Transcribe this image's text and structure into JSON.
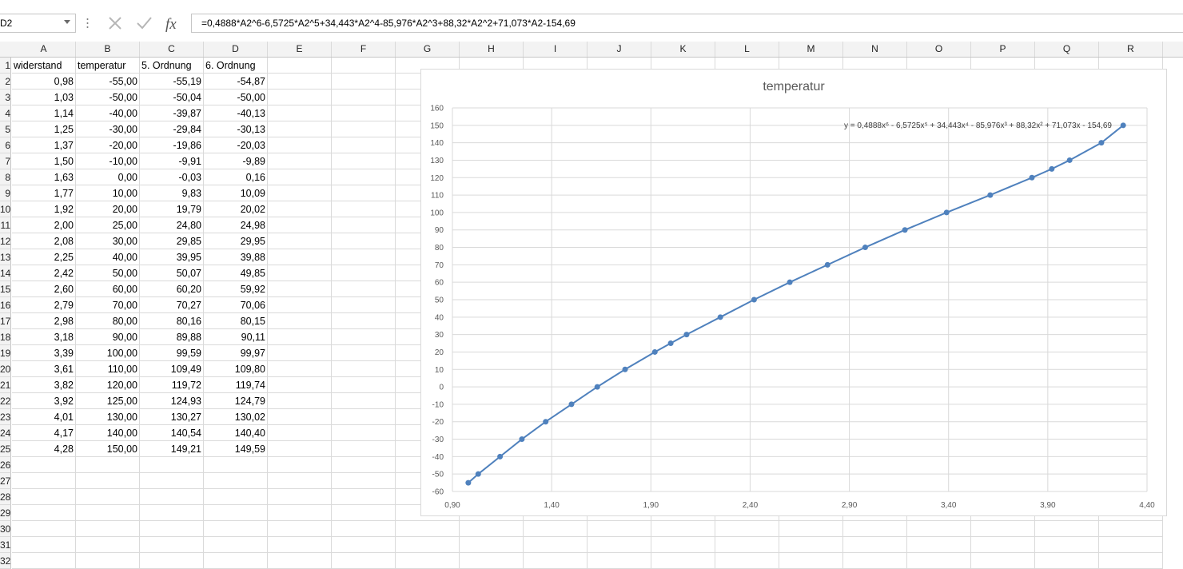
{
  "name_box": {
    "value": "D2"
  },
  "formula_bar": {
    "formula": "=0,4888*A2^6-6,5725*A2^5+34,443*A2^4-85,976*A2^3+88,32*A2^2+71,073*A2-154,69"
  },
  "columns": [
    "A",
    "B",
    "C",
    "D",
    "E",
    "F",
    "G",
    "H",
    "I",
    "J",
    "K",
    "L",
    "M",
    "N",
    "O",
    "P",
    "Q",
    "R"
  ],
  "rows": [
    "1",
    "2",
    "3",
    "4",
    "5",
    "6",
    "7",
    "8",
    "9",
    "10",
    "11",
    "12",
    "13",
    "14",
    "15",
    "16",
    "17",
    "18",
    "19",
    "20",
    "21",
    "22",
    "23",
    "24",
    "25",
    "26",
    "27",
    "28",
    "29",
    "30",
    "31",
    "32"
  ],
  "headers": [
    "widerstand",
    "temperatur",
    "5. Ordnung",
    "6. Ordnung"
  ],
  "table": [
    [
      "0,98",
      "-55,00",
      "-55,19",
      "-54,87"
    ],
    [
      "1,03",
      "-50,00",
      "-50,04",
      "-50,00"
    ],
    [
      "1,14",
      "-40,00",
      "-39,87",
      "-40,13"
    ],
    [
      "1,25",
      "-30,00",
      "-29,84",
      "-30,13"
    ],
    [
      "1,37",
      "-20,00",
      "-19,86",
      "-20,03"
    ],
    [
      "1,50",
      "-10,00",
      "-9,91",
      "-9,89"
    ],
    [
      "1,63",
      "0,00",
      "-0,03",
      "0,16"
    ],
    [
      "1,77",
      "10,00",
      "9,83",
      "10,09"
    ],
    [
      "1,92",
      "20,00",
      "19,79",
      "20,02"
    ],
    [
      "2,00",
      "25,00",
      "24,80",
      "24,98"
    ],
    [
      "2,08",
      "30,00",
      "29,85",
      "29,95"
    ],
    [
      "2,25",
      "40,00",
      "39,95",
      "39,88"
    ],
    [
      "2,42",
      "50,00",
      "50,07",
      "49,85"
    ],
    [
      "2,60",
      "60,00",
      "60,20",
      "59,92"
    ],
    [
      "2,79",
      "70,00",
      "70,27",
      "70,06"
    ],
    [
      "2,98",
      "80,00",
      "80,16",
      "80,15"
    ],
    [
      "3,18",
      "90,00",
      "89,88",
      "90,11"
    ],
    [
      "3,39",
      "100,00",
      "99,59",
      "99,97"
    ],
    [
      "3,61",
      "110,00",
      "109,49",
      "109,80"
    ],
    [
      "3,82",
      "120,00",
      "119,72",
      "119,74"
    ],
    [
      "3,92",
      "125,00",
      "124,93",
      "124,79"
    ],
    [
      "4,01",
      "130,00",
      "130,27",
      "130,02"
    ],
    [
      "4,17",
      "140,00",
      "140,54",
      "140,40"
    ],
    [
      "4,28",
      "150,00",
      "149,21",
      "149,59"
    ]
  ],
  "chart_data": {
    "type": "scatter",
    "title": "temperatur",
    "x": [
      0.98,
      1.03,
      1.14,
      1.25,
      1.37,
      1.5,
      1.63,
      1.77,
      1.92,
      2.0,
      2.08,
      2.25,
      2.42,
      2.6,
      2.79,
      2.98,
      3.18,
      3.39,
      3.61,
      3.82,
      3.92,
      4.01,
      4.17,
      4.28
    ],
    "y": [
      -55,
      -50,
      -40,
      -30,
      -20,
      -10,
      0,
      10,
      20,
      25,
      30,
      40,
      50,
      60,
      70,
      80,
      90,
      100,
      110,
      120,
      125,
      130,
      140,
      150
    ],
    "xlim": [
      0.9,
      4.4
    ],
    "ylim": [
      -60,
      160
    ],
    "x_ticks": [
      "0,90",
      "1,40",
      "1,90",
      "2,40",
      "2,90",
      "3,40",
      "3,90",
      "4,40"
    ],
    "y_ticks": [
      "160",
      "150",
      "140",
      "130",
      "120",
      "110",
      "100",
      "90",
      "80",
      "70",
      "60",
      "50",
      "40",
      "30",
      "20",
      "10",
      "0",
      "-10",
      "-20",
      "-30",
      "-40",
      "-50",
      "-60"
    ],
    "trendline": {
      "label": "y = 0,4888x⁶ - 6,5725x⁵ + 34,443x⁴ - 85,976x³ + 88,32x² + 71,073x - 154,69"
    },
    "grid": true,
    "series_color": "#4f81bd"
  }
}
